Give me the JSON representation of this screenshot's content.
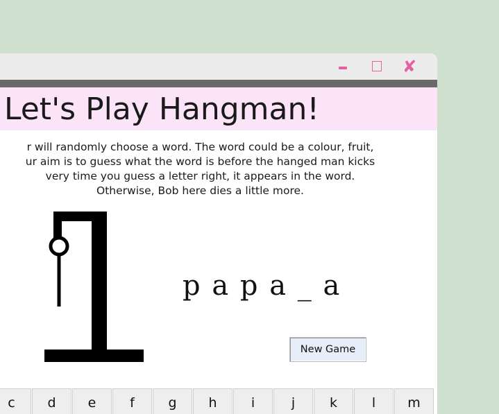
{
  "window": {
    "controls": {
      "minimize_icon": "minimize-icon",
      "maximize_icon": "maximize-icon",
      "close_icon": "close-icon",
      "close_glyph": "✘"
    }
  },
  "header": {
    "title": "Let's Play Hangman!"
  },
  "description": {
    "lines": [
      "r will randomly choose a word. The word could be a colour, fruit,",
      "ur aim is to guess what the word is before the hanged man kicks",
      "very time you guess a letter right, it appears in the word.",
      "Otherwise, Bob here dies a little more."
    ]
  },
  "game": {
    "word_display": "p a p a _ a",
    "new_game_label": "New Game"
  },
  "keyboard": {
    "letters": [
      "c",
      "d",
      "e",
      "f",
      "g",
      "h",
      "i",
      "j",
      "k",
      "l",
      "m"
    ]
  },
  "colors": {
    "background": "#cfe0cf",
    "header_bg": "#fbe4f7",
    "accent": "#e5609e",
    "bar": "#696969"
  }
}
